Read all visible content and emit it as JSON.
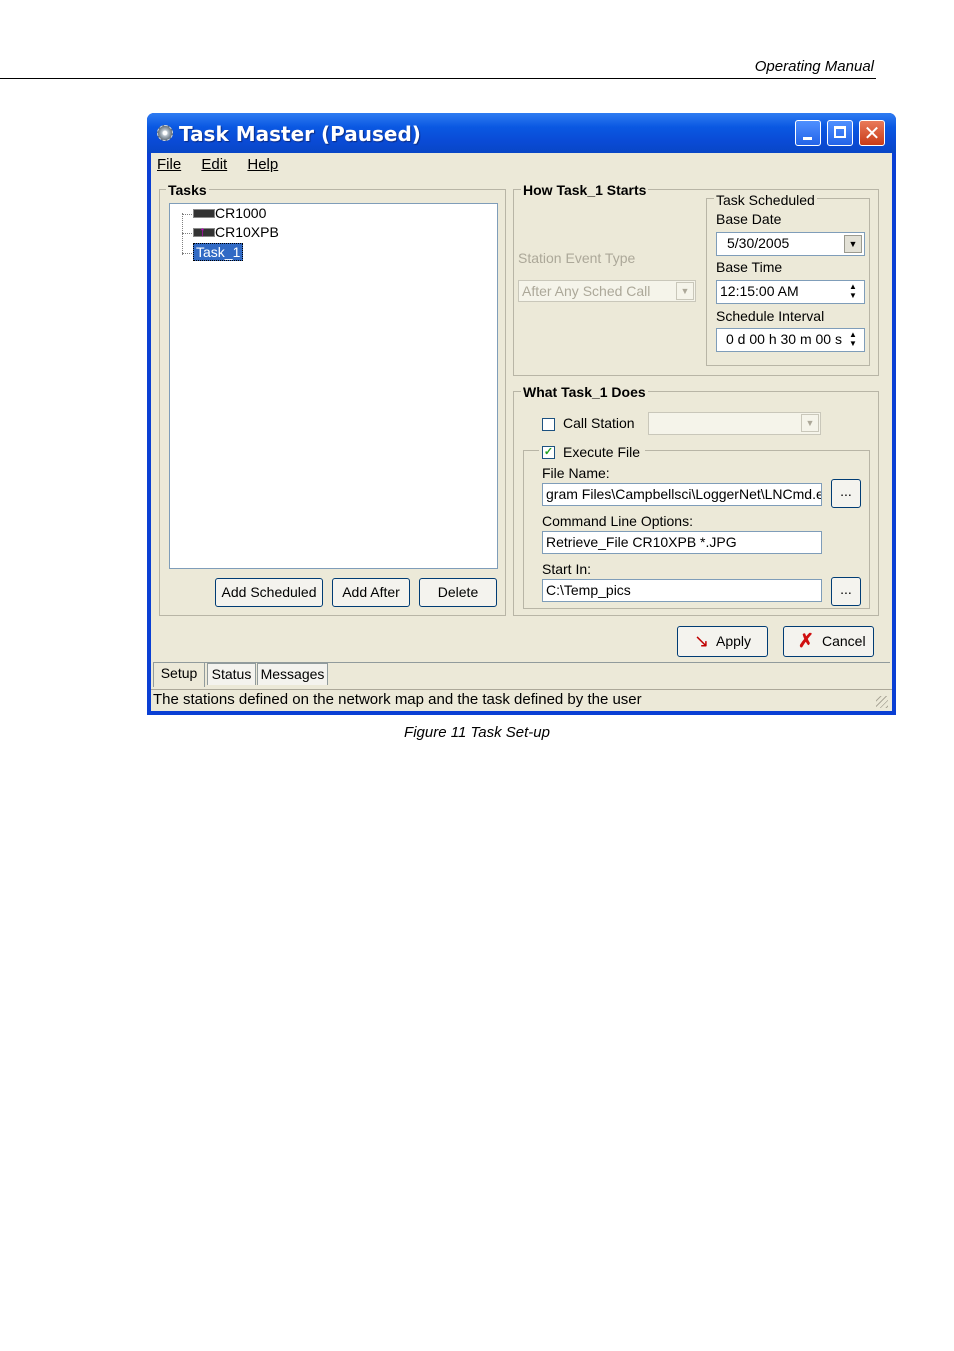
{
  "doc": {
    "header": "Operating Manual",
    "caption": "Figure 11  Task Set-up"
  },
  "window": {
    "title": "Task Master (Paused)",
    "menu": [
      "File",
      "Edit",
      "Help"
    ]
  },
  "tasks": {
    "label": "Tasks",
    "tree": [
      "CR1000",
      "CR10XPB",
      "Task_1"
    ],
    "selected": "Task_1",
    "buttons": {
      "add_scheduled": "Add Scheduled",
      "add_after": "Add After",
      "delete": "Delete"
    }
  },
  "how": {
    "label": "How Task_1 Starts",
    "event_type_label": "Station Event Type",
    "event_type_value": "After Any Sched Call",
    "scheduled": {
      "label": "Task Scheduled",
      "base_date_label": "Base Date",
      "base_date": "5/30/2005",
      "base_time_label": "Base Time",
      "base_time": "12:15:00 AM",
      "interval_label": "Schedule Interval",
      "interval": "0 d 00 h 30 m 00 s"
    }
  },
  "what": {
    "label": "What Task_1 Does",
    "call_station_label": "Call Station",
    "call_station_checked": false,
    "execute_file_label": "Execute File",
    "execute_file_checked": true,
    "file_name_label": "File Name:",
    "file_name": "gram Files\\Campbellsci\\LoggerNet\\LNCmd.exe",
    "cmd_label": "Command Line Options:",
    "cmd": "Retrieve_File CR10XPB *.JPG",
    "start_in_label": "Start In:",
    "start_in": "C:\\Temp_pics",
    "browse": "..."
  },
  "actions": {
    "apply": "Apply",
    "cancel": "Cancel"
  },
  "tabs": [
    "Setup",
    "Status",
    "Messages"
  ],
  "status_text": "The stations defined on the network map and the task defined by the user",
  "colors": {
    "titlebar": "#0a58e2",
    "dialog_bg": "#ece9d8",
    "selection": "#316ac5"
  }
}
